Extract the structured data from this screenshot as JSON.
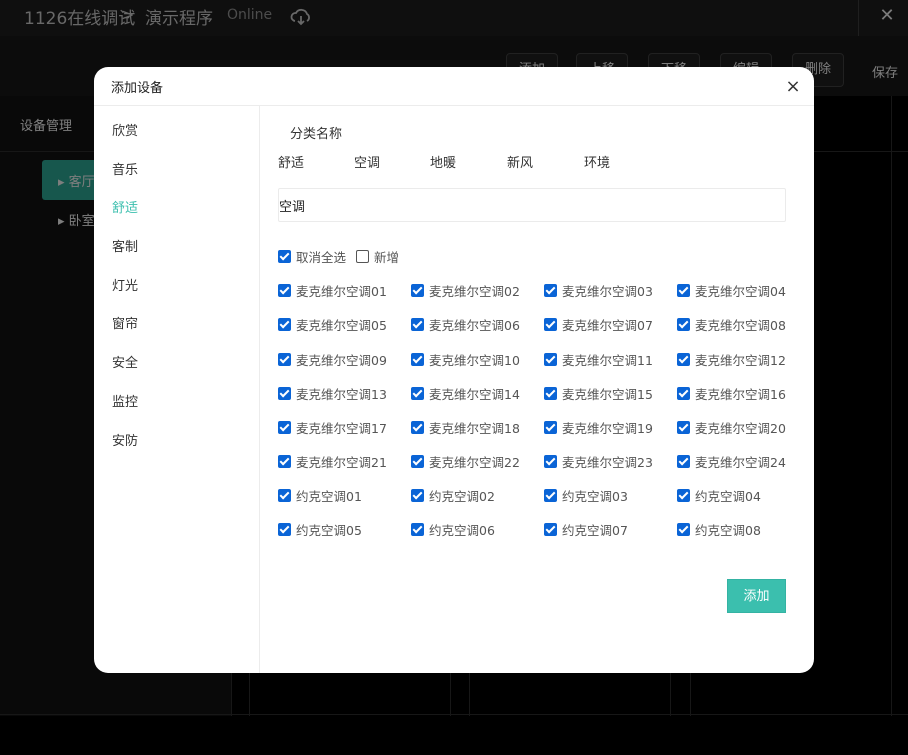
{
  "app": {
    "title": "1126在线调试",
    "breadcrumb_sep": ">",
    "page": "演示程序",
    "status": "Online",
    "close": "✕"
  },
  "toolbar": {
    "buttons": [
      "添加",
      "上移",
      "下移",
      "编辑",
      "删除"
    ],
    "save": "保存"
  },
  "left_panel": {
    "title": "设备管理",
    "tree": [
      "客厅",
      "卧室"
    ]
  },
  "modal": {
    "title": "添加设备",
    "close": "×",
    "categories": [
      "欣赏",
      "音乐",
      "舒适",
      "客制",
      "灯光",
      "窗帘",
      "安全",
      "监控",
      "安防"
    ],
    "active_category": "舒适",
    "section_label": "分类名称",
    "sub_tabs": [
      "舒适",
      "空调",
      "地暖",
      "新风",
      "环境"
    ],
    "name_value": "空调",
    "select_all": {
      "label": "取消全选",
      "checked": true
    },
    "add_new": {
      "label": "新增",
      "checked": false
    },
    "devices": [
      "麦克维尔空调01",
      "麦克维尔空调02",
      "麦克维尔空调03",
      "麦克维尔空调04",
      "麦克维尔空调05",
      "麦克维尔空调06",
      "麦克维尔空调07",
      "麦克维尔空调08",
      "麦克维尔空调09",
      "麦克维尔空调10",
      "麦克维尔空调11",
      "麦克维尔空调12",
      "麦克维尔空调13",
      "麦克维尔空调14",
      "麦克维尔空调15",
      "麦克维尔空调16",
      "麦克维尔空调17",
      "麦克维尔空调18",
      "麦克维尔空调19",
      "麦克维尔空调20",
      "麦克维尔空调21",
      "麦克维尔空调22",
      "麦克维尔空调23",
      "麦克维尔空调24",
      "约克空调01",
      "约克空调02",
      "约克空调03",
      "约克空调04",
      "约克空调05",
      "约克空调06",
      "约克空调07",
      "约克空调08"
    ],
    "add_button": "添加"
  },
  "colors": {
    "accent": "#3bbfae",
    "checkbox": "#0a64d6",
    "background": "#000000"
  }
}
